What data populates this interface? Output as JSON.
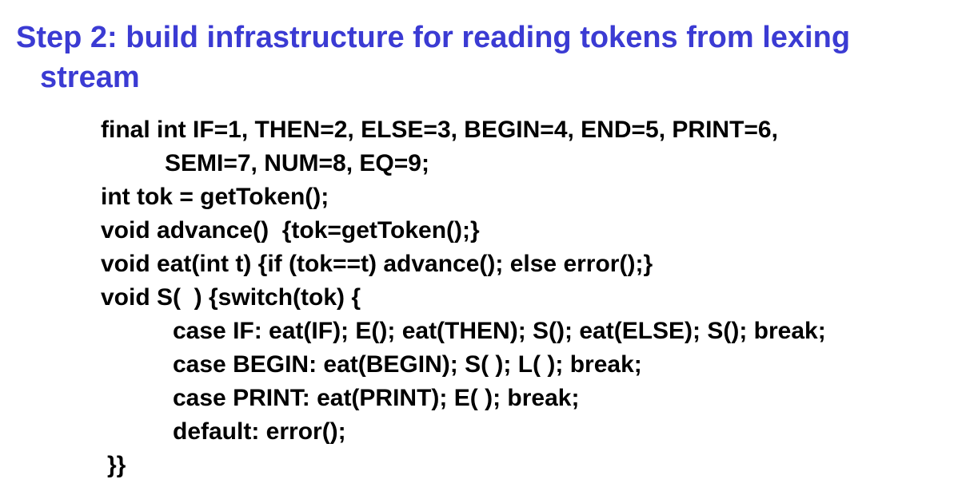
{
  "slide": {
    "title_line1": "Step 2: build infrastructure for reading tokens from lexing",
    "title_line2": "stream",
    "title_color": "#3b3bd3",
    "code_lines": [
      "final int IF=1, THEN=2, ELSE=3, BEGIN=4, END=5, PRINT=6,",
      "SEMI=7, NUM=8, EQ=9;",
      "int tok = getToken();",
      "void advance()  {tok=getToken();}",
      "void eat(int t) {if (tok==t) advance(); else error();}",
      "void S(  ) {switch(tok) {",
      "case IF: eat(IF); E(); eat(THEN); S(); eat(ELSE); S(); break;",
      "case BEGIN: eat(BEGIN); S( ); L( ); break;",
      "case PRINT: eat(PRINT); E( ); break;",
      "default: error();",
      "}}"
    ]
  }
}
